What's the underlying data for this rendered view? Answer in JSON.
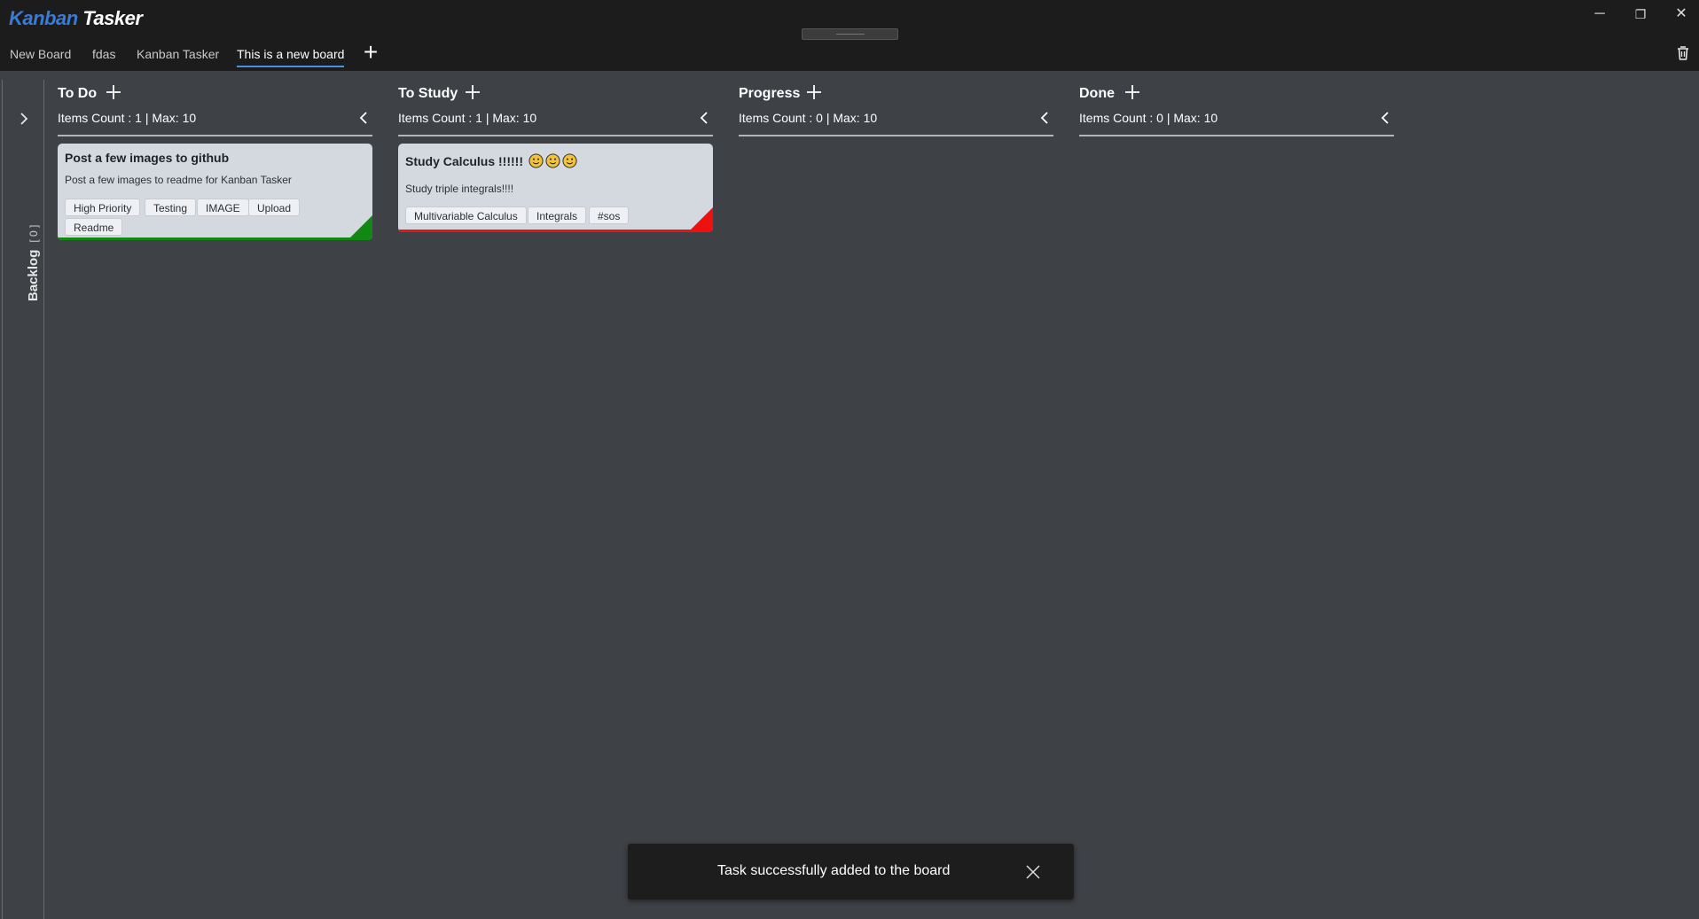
{
  "app": {
    "title_part1": "Kanban",
    "title_part2": "Tasker"
  },
  "window_controls": {
    "minimize": "─",
    "restore": "❐",
    "close": "✕"
  },
  "tabs": [
    {
      "label": "New Board",
      "active": false
    },
    {
      "label": "fdas",
      "active": false
    },
    {
      "label": "Kanban Tasker",
      "active": false
    },
    {
      "label": "This is a new board",
      "active": true
    }
  ],
  "add_tab": "+",
  "backlog": {
    "label": "Backlog",
    "count": "[ 0 ]"
  },
  "columns": [
    {
      "title": "To Do",
      "meta": "Items Count : 1  |  Max: 10",
      "cards": [
        {
          "title": "Post a few images to github",
          "description": "Post a few images to readme for Kanban Tasker",
          "tags": [
            "High Priority",
            "Testing",
            "IMAGE",
            "Upload",
            "Readme"
          ],
          "color": "#118811"
        }
      ]
    },
    {
      "title": "To Study",
      "meta": "Items Count : 1  |  Max: 10",
      "cards": [
        {
          "title": "Study Calculus !!!!!!",
          "description": "Study triple integrals!!!!",
          "tags": [
            "Multivariable Calculus",
            "Integrals",
            "#sos"
          ],
          "color": "#ee1111"
        }
      ]
    },
    {
      "title": "Progress",
      "meta": "Items Count : 0  |  Max: 10",
      "cards": []
    },
    {
      "title": "Done",
      "meta": "Items Count : 0  |  Max: 10",
      "cards": []
    }
  ],
  "toast": {
    "message": "Task successfully added to the board"
  },
  "colors": {
    "accent": "#4a90e2",
    "logo_blue": "#3a7bd5",
    "background": "#3e4247",
    "titlebar": "#1c1c1c"
  }
}
